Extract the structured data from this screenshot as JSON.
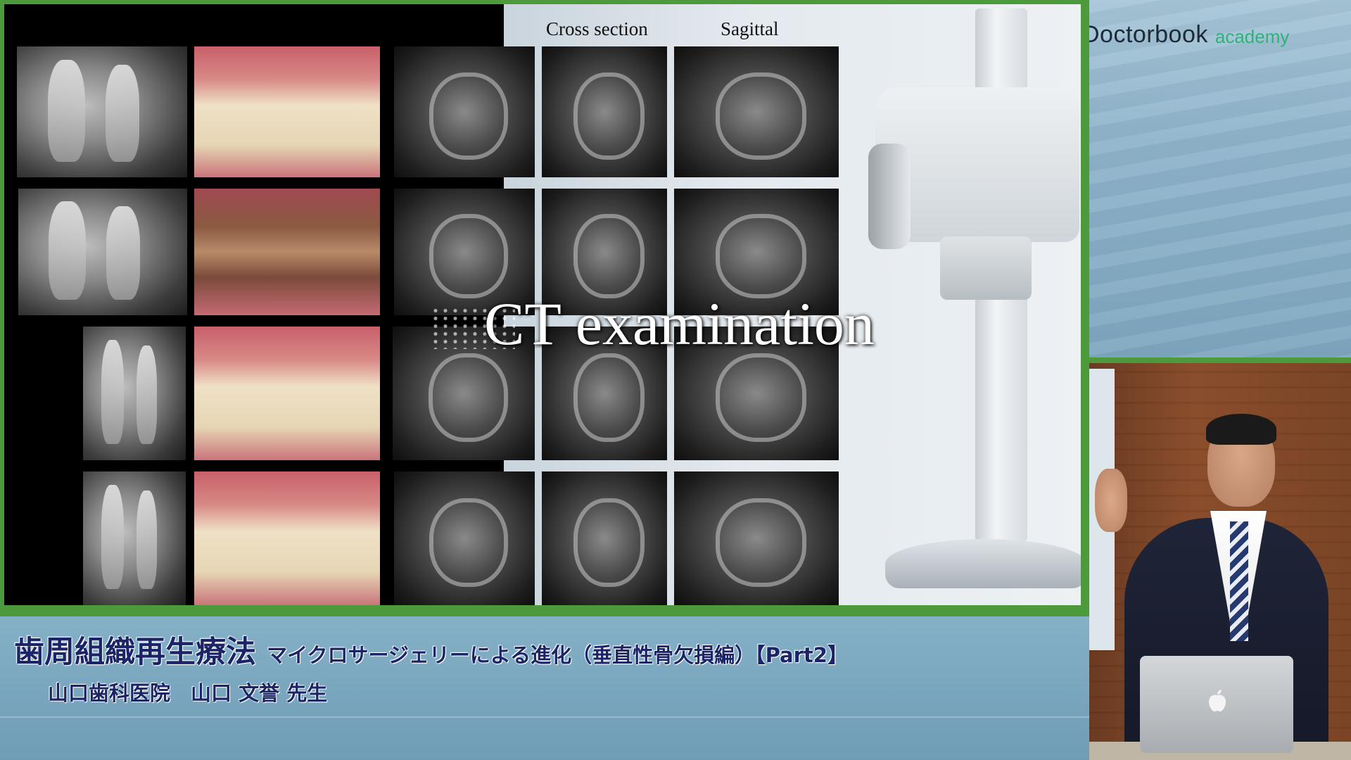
{
  "slide": {
    "column_headers": [
      "Cross section",
      "Sagittal"
    ],
    "overlay_title": "CT examination"
  },
  "brand": {
    "name": "Doctorbook",
    "sub": "academy",
    "accent_color": "#2fb27a"
  },
  "caption": {
    "title_main": "歯周組織再生療法",
    "title_sub": "マイクロサージェリーによる進化（垂直性骨欠損編）【Part2】",
    "lecturer": "山口歯科医院　山口 文誉 先生",
    "text_color": "#1b2466"
  },
  "colors": {
    "frame_green": "#4c9a3c",
    "band_blue": "#79a6be"
  }
}
